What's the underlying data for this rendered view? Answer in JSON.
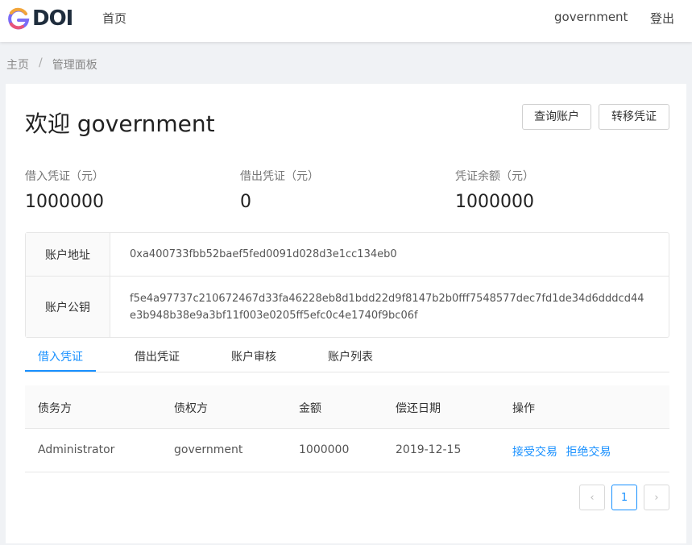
{
  "header": {
    "logo_text": "DOI",
    "nav_home": "首页",
    "user_name": "government",
    "logout": "登出"
  },
  "breadcrumb": {
    "home": "主页",
    "separator": "/",
    "current": "管理面板"
  },
  "welcome": "欢迎 government",
  "actions": {
    "query_account": "查询账户",
    "transfer_voucher": "转移凭证"
  },
  "stats": [
    {
      "label": "借入凭证（元）",
      "value": "1000000"
    },
    {
      "label": "借出凭证（元）",
      "value": "0"
    },
    {
      "label": "凭证余额（元）",
      "value": "1000000"
    }
  ],
  "account": {
    "address_label": "账户地址",
    "address": "0xa400733fbb52baef5fed0091d028d3e1cc134eb0",
    "pubkey_label": "账户公钥",
    "pubkey": "f5e4a97737c210672467d33fa46228eb8d1bdd22d9f8147b2b0fff7548577dec7fd1de34d6dddcd44e3b948b38e9a3bf11f003e0205ff5efc0c4e1740f9bc06f"
  },
  "tabs": [
    {
      "label": "借入凭证",
      "active": true
    },
    {
      "label": "借出凭证",
      "active": false
    },
    {
      "label": "账户审核",
      "active": false
    },
    {
      "label": "账户列表",
      "active": false
    }
  ],
  "table": {
    "columns": [
      "债务方",
      "债权方",
      "金额",
      "偿还日期",
      "操作"
    ],
    "rows": [
      {
        "debtor": "Administrator",
        "creditor": "government",
        "amount": "1000000",
        "due_date": "2019-12-15",
        "accept": "接受交易",
        "reject": "拒绝交易"
      }
    ]
  },
  "pagination": {
    "prev": "‹",
    "current": "1",
    "next": "›"
  },
  "colors": {
    "accent": "#1890ff"
  }
}
